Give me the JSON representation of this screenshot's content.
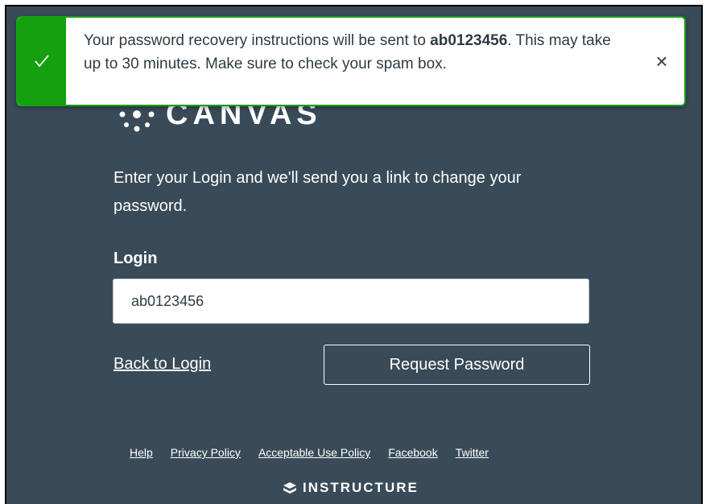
{
  "toast": {
    "message_prefix": "Your password recovery instructions will be sent to",
    "login_bold": "ab0123456",
    "message_suffix": ". This may take up to 30 minutes. Make sure to check your spam box.",
    "close_glyph": "×",
    "icon": "checkmark-icon",
    "accent": "#15a10f"
  },
  "logo": {
    "wordmark": "CANVAS",
    "icon": "canvas-logo-icon"
  },
  "form": {
    "instructions": "Enter your Login and we'll send you a link to change your password.",
    "login_label": "Login",
    "login_value": "ab0123456",
    "back_link": "Back to Login",
    "submit_label": "Request Password"
  },
  "footer": {
    "links": [
      "Help",
      "Privacy Policy",
      "Acceptable Use Policy",
      "Facebook",
      "Twitter"
    ],
    "brand": "INSTRUCTURE",
    "brand_icon": "instructure-logo-icon"
  },
  "colors": {
    "background": "#394b58",
    "toast_border": "#16a314"
  }
}
